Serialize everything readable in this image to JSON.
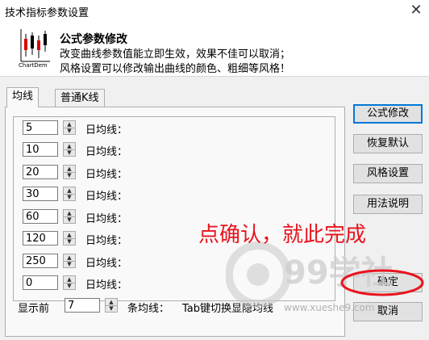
{
  "window": {
    "title": "技术指标参数设置"
  },
  "header": {
    "title": "公式参数修改",
    "desc_line1": "改变曲线参数值能立即生效，效果不佳可以取消；",
    "desc_line2": "风格设置可以修改输出曲线的颜色、粗细等风格！"
  },
  "tabs": [
    {
      "label": "均线"
    },
    {
      "label": "普通K线"
    }
  ],
  "params": [
    {
      "value": "5",
      "label": "日均线："
    },
    {
      "value": "10",
      "label": "日均线："
    },
    {
      "value": "20",
      "label": "日均线："
    },
    {
      "value": "30",
      "label": "日均线："
    },
    {
      "value": "60",
      "label": "日均线："
    },
    {
      "value": "120",
      "label": "日均线："
    },
    {
      "value": "250",
      "label": "日均线："
    },
    {
      "value": "0",
      "label": "日均线："
    }
  ],
  "display": {
    "prefix": "显示前",
    "value": "7",
    "suffix": "条均线：",
    "hint": "Tab键切换显隐均线"
  },
  "buttons": {
    "formula": "公式修改",
    "restore": "恢复默认",
    "style": "风格设置",
    "help": "用法说明",
    "ok": "确定",
    "cancel": "取消"
  },
  "annotation": {
    "text": "点确认，就此完成",
    "color": "#e8141e"
  },
  "watermark": {
    "url": "www.xueshe9.com",
    "brand": "99学社"
  }
}
